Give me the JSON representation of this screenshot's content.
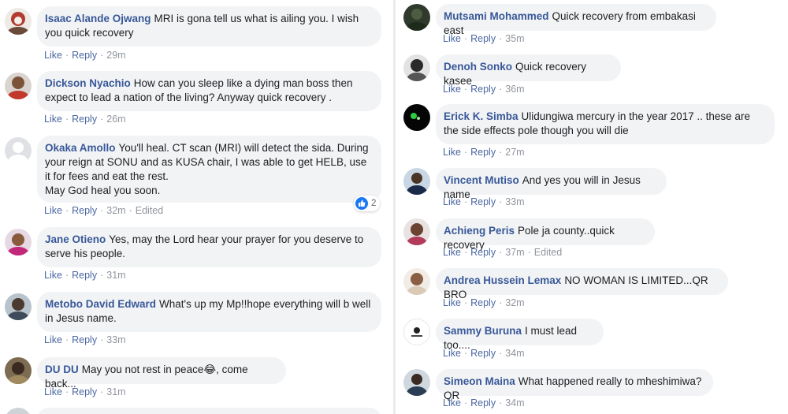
{
  "left_comments": [
    {
      "author": "Isaac Alande Ojwang",
      "text": "MRI is gona tell us what is ailing you. I wish you quick recovery",
      "time": "29m",
      "edited": ""
    },
    {
      "author": "Dickson Nyachio",
      "text": "How can you sleep like a dying man boss then expect to lead a nation of the living? Anyway quick recovery .",
      "time": "26m",
      "edited": ""
    },
    {
      "author": "Okaka Amollo",
      "text": "You'll heal. CT scan (MRI) will detect the sida. During your reign at SONU and as KUSA chair, I was able to get HELB, use it for fees and eat the rest.",
      "text2": "May God heal you soon.",
      "time": "32m",
      "edited": "Edited",
      "reactions": "2"
    },
    {
      "author": "Jane Otieno",
      "text": "Yes, may the Lord hear your prayer for you deserve to serve his people.",
      "time": "31m",
      "edited": ""
    },
    {
      "author": "Metobo David Edward",
      "text": "What's up my Mp!!hope everything will b well in Jesus name.",
      "time": "33m",
      "edited": ""
    },
    {
      "author": "DU DU",
      "text": "May you not rest in peace",
      "emoji": "😂",
      "text_after": ", come back...",
      "time": "31m",
      "edited": ""
    }
  ],
  "right_comments": [
    {
      "author": "Mutsami Mohammed",
      "text": "Quick recovery from embakasi east",
      "time": "35m",
      "edited": ""
    },
    {
      "author": "Denoh Sonko",
      "text": "Quick recovery kasee",
      "time": "36m",
      "edited": ""
    },
    {
      "author": "Erick K. Simba",
      "text": "Ulidungiwa mercury in the year 2017 .. these are the side effects pole though you will die",
      "time": "27m",
      "edited": ""
    },
    {
      "author": "Vincent Mutiso",
      "text": "And yes you will in Jesus name",
      "time": "33m",
      "edited": ""
    },
    {
      "author": "Achieng Peris",
      "text": "Pole ja county..quick recovery",
      "time": "37m",
      "edited": "Edited"
    },
    {
      "author": "Andrea Hussein Lemax",
      "text": "NO WOMAN IS LIMITED...QR BRO",
      "time": "32m",
      "edited": ""
    },
    {
      "author": "Sammy Buruna",
      "text": "I must lead too....",
      "time": "34m",
      "edited": ""
    },
    {
      "author": "Simeon Maina",
      "text": "What happened really to mheshimiwa?QR",
      "time": "34m",
      "edited": ""
    }
  ],
  "actions": {
    "like": "Like",
    "reply": "Reply",
    "separator": "·"
  },
  "colors": {
    "author": "#385898",
    "bubble": "#f2f3f5",
    "meta": "#90949c",
    "like_blue": "#1877f2"
  }
}
